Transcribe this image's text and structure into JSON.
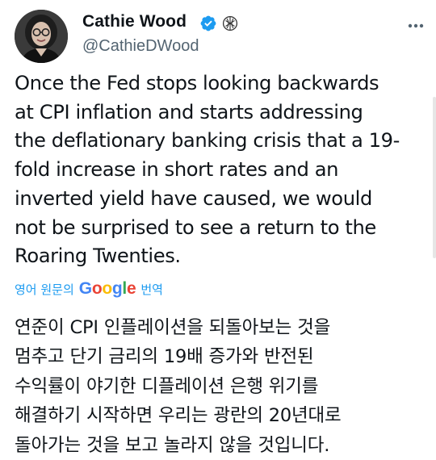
{
  "author": {
    "name": "Cathie Wood",
    "handle": "@CathieDWood",
    "verified_color": "#1d9bf0"
  },
  "tweet": {
    "text": "Once the Fed stops looking backwards\nat CPI inflation and starts addressing\nthe deflationary banking crisis that a 19-\nfold increase in short rates and an\ninverted yield have caused, we would\nnot be surprised to see a return to the\nRoaring Twenties.",
    "translated_text": "연준이 CPI 인플레이션을 되돌아보는 것을\n멈추고 단기 금리의 19배 증가와 반전된\n수익률이 야기한 디플레이션 은행 위기를\n해결하기 시작하면 우리는 광란의 20년대로\n돌아가는 것을 보고 놀라지 않을 것입니다."
  },
  "translation": {
    "prefix": "영어 원문의",
    "provider_letters": [
      "G",
      "o",
      "o",
      "g",
      "l",
      "e"
    ],
    "suffix": "번역",
    "link_color": "#1d9bf0"
  },
  "icons": {
    "verified": "verified-badge-icon",
    "affiliation": "affiliation-badge-icon",
    "more": "more-options-icon"
  }
}
